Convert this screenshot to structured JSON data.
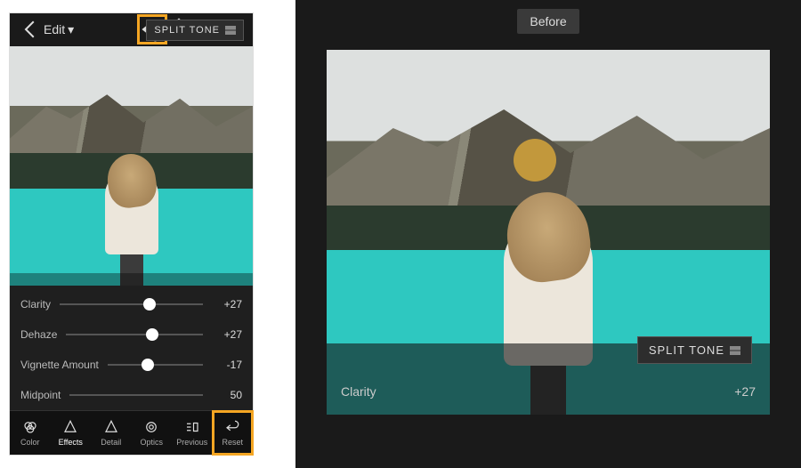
{
  "header": {
    "back_label": "Edit",
    "dropdown_glyph": "▾"
  },
  "preview_label": "Before",
  "split_tone_label": "SPLIT TONE",
  "sliders": [
    {
      "label": "Clarity",
      "value": "+27",
      "pos": 63
    },
    {
      "label": "Dehaze",
      "value": "+27",
      "pos": 63
    },
    {
      "label": "Vignette Amount",
      "value": "-17",
      "pos": 42
    },
    {
      "label": "Midpoint",
      "value": "50",
      "pos": 50
    }
  ],
  "tabs": {
    "color": "Color",
    "effects": "Effects",
    "detail": "Detail",
    "optics": "Optics",
    "previous": "Previous",
    "reset": "Reset"
  },
  "right_slider": {
    "label": "Clarity",
    "value": "+27"
  },
  "colors": {
    "highlight": "#f5a623",
    "water": "#2ec8c0"
  }
}
